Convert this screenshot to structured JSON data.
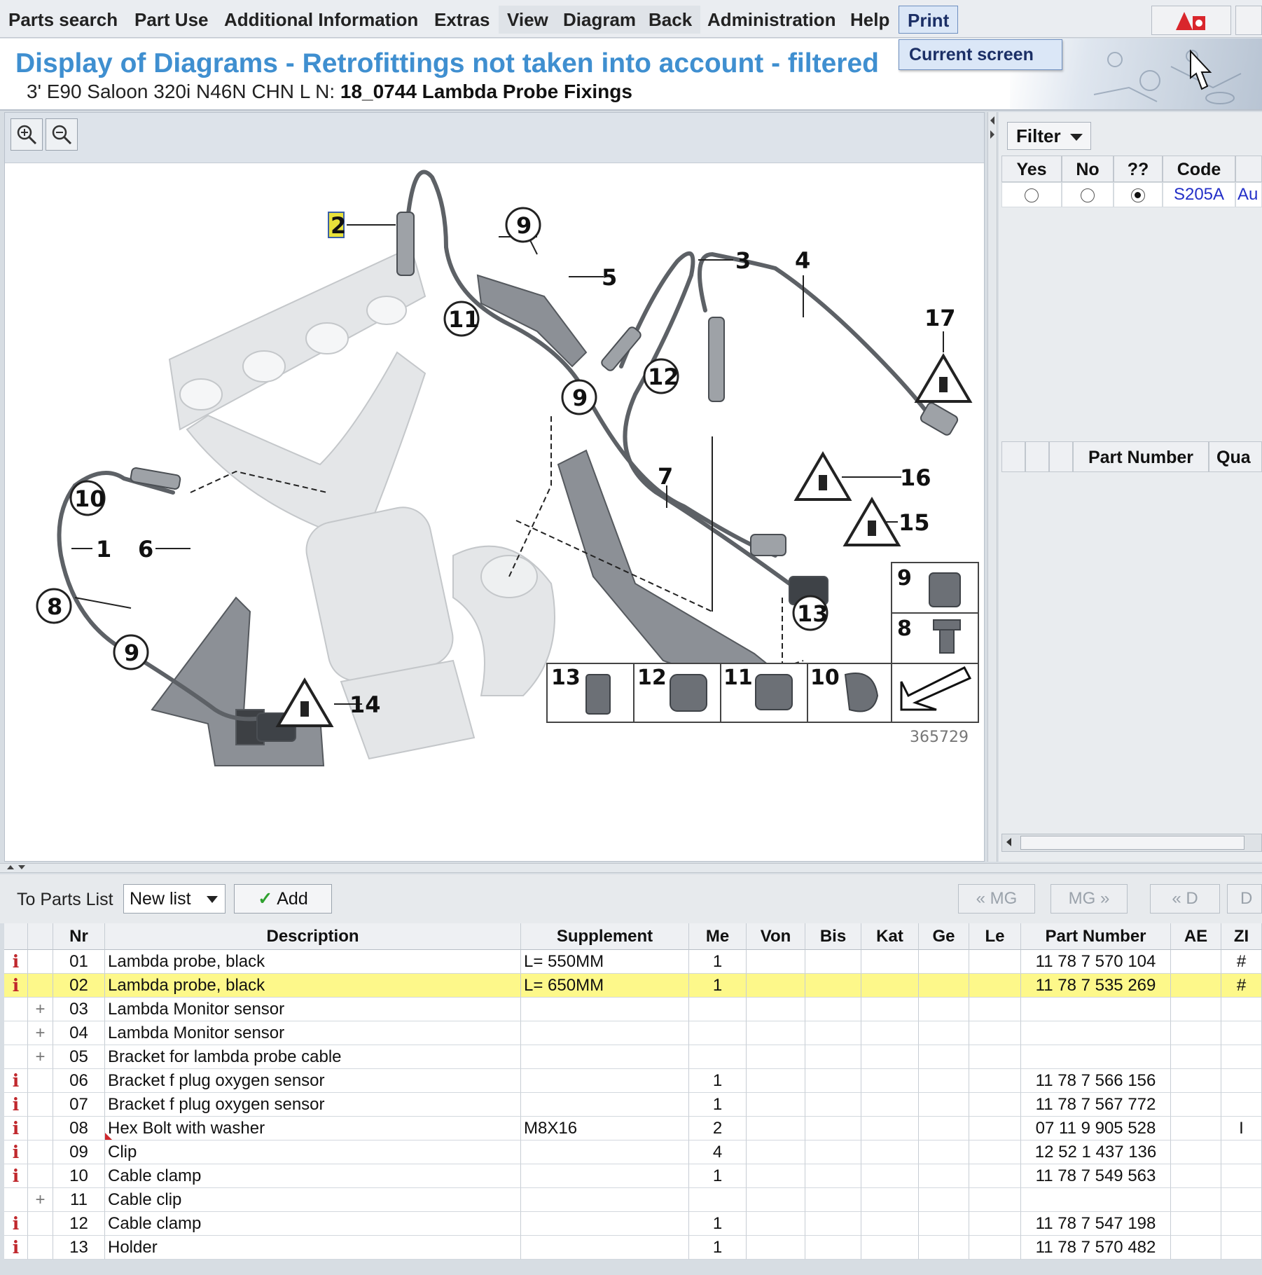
{
  "menu": {
    "items": [
      {
        "label": "Parts search"
      },
      {
        "label": "Part Use"
      },
      {
        "label": "Additional Information"
      },
      {
        "label": "Extras"
      },
      {
        "label": "View"
      },
      {
        "label": "Diagram"
      },
      {
        "label": "Back"
      },
      {
        "label": "Administration"
      },
      {
        "label": "Help"
      },
      {
        "label": "Print"
      }
    ],
    "print_dropdown": [
      "Current screen"
    ]
  },
  "header": {
    "title": "Display of Diagrams - Retrofittings not taken into account - filtered",
    "subtitle_prefix": "3' E90 Saloon 320i N46N CHN  L N: ",
    "subtitle_bold": "18_0744 Lambda Probe Fixings"
  },
  "diagram": {
    "zoom_in_icon": "zoom-in-icon",
    "zoom_out_icon": "zoom-out-icon",
    "callouts": [
      "1",
      "2",
      "3",
      "4",
      "5",
      "6",
      "7",
      "8",
      "9",
      "10",
      "11",
      "12",
      "13",
      "14",
      "15",
      "16",
      "17"
    ],
    "inset_labels": [
      "9",
      "8",
      "13",
      "12",
      "11",
      "10"
    ],
    "image_number": "365729"
  },
  "filter": {
    "button_label": "Filter",
    "columns": [
      "Yes",
      "No",
      "??",
      "Code",
      "Au"
    ],
    "row": {
      "selected": "??",
      "code": "S205A",
      "desc": "Au"
    },
    "parts_columns": [
      "Part Number",
      "Qua"
    ]
  },
  "bottom_toolbar": {
    "to_parts_list_label": "To Parts List",
    "new_list_value": "New list",
    "add_label": "Add",
    "nav_buttons": [
      "« MG",
      "MG »",
      "« D",
      "D"
    ]
  },
  "parts_table": {
    "columns": [
      "",
      "",
      "Nr",
      "Description",
      "Supplement",
      "Me",
      "Von",
      "Bis",
      "Kat",
      "Ge",
      "Le",
      "Part Number",
      "AE",
      "ZI"
    ],
    "rows": [
      {
        "icon": "info",
        "nr": "01",
        "description": "Lambda probe, black",
        "supplement": "L= 550MM",
        "me": "1",
        "part_number": "11 78 7 570 104",
        "zi": "#",
        "selected": false
      },
      {
        "icon": "info",
        "nr": "02",
        "description": "Lambda probe, black",
        "supplement": "L= 650MM",
        "me": "1",
        "part_number": "11 78 7 535 269",
        "zi": "#",
        "selected": true
      },
      {
        "icon": "plus",
        "nr": "03",
        "description": "Lambda Monitor sensor",
        "supplement": "",
        "me": "",
        "part_number": "",
        "zi": "",
        "selected": false
      },
      {
        "icon": "plus",
        "nr": "04",
        "description": "Lambda Monitor sensor",
        "supplement": "",
        "me": "",
        "part_number": "",
        "zi": "",
        "selected": false
      },
      {
        "icon": "plus",
        "nr": "05",
        "description": "Bracket for lambda probe cable",
        "supplement": "",
        "me": "",
        "part_number": "",
        "zi": "",
        "selected": false
      },
      {
        "icon": "info",
        "nr": "06",
        "description": "Bracket f plug oxygen sensor",
        "supplement": "",
        "me": "1",
        "part_number": "11 78 7 566 156",
        "zi": "",
        "selected": false
      },
      {
        "icon": "info",
        "nr": "07",
        "description": "Bracket f plug oxygen sensor",
        "supplement": "",
        "me": "1",
        "part_number": "11 78 7 567 772",
        "zi": "",
        "selected": false
      },
      {
        "icon": "info",
        "nr": "08",
        "description": "Hex Bolt with washer",
        "supplement": "M8X16",
        "me": "2",
        "part_number": "07 11 9 905 528",
        "zi": "I",
        "selected": false
      },
      {
        "icon": "info",
        "nr": "09",
        "description": "Clip",
        "supplement": "",
        "me": "4",
        "part_number": "12 52 1 437 136",
        "zi": "",
        "selected": false
      },
      {
        "icon": "info",
        "nr": "10",
        "description": "Cable clamp",
        "supplement": "",
        "me": "1",
        "part_number": "11 78 7 549 563",
        "zi": "",
        "selected": false
      },
      {
        "icon": "plus",
        "nr": "11",
        "description": "Cable clip",
        "supplement": "",
        "me": "",
        "part_number": "",
        "zi": "",
        "selected": false
      },
      {
        "icon": "info",
        "nr": "12",
        "description": "Cable clamp",
        "supplement": "",
        "me": "1",
        "part_number": "11 78 7 547 198",
        "zi": "",
        "selected": false
      },
      {
        "icon": "info",
        "nr": "13",
        "description": "Holder",
        "supplement": "",
        "me": "1",
        "part_number": "11 78 7 570 482",
        "zi": "",
        "selected": false
      }
    ]
  }
}
